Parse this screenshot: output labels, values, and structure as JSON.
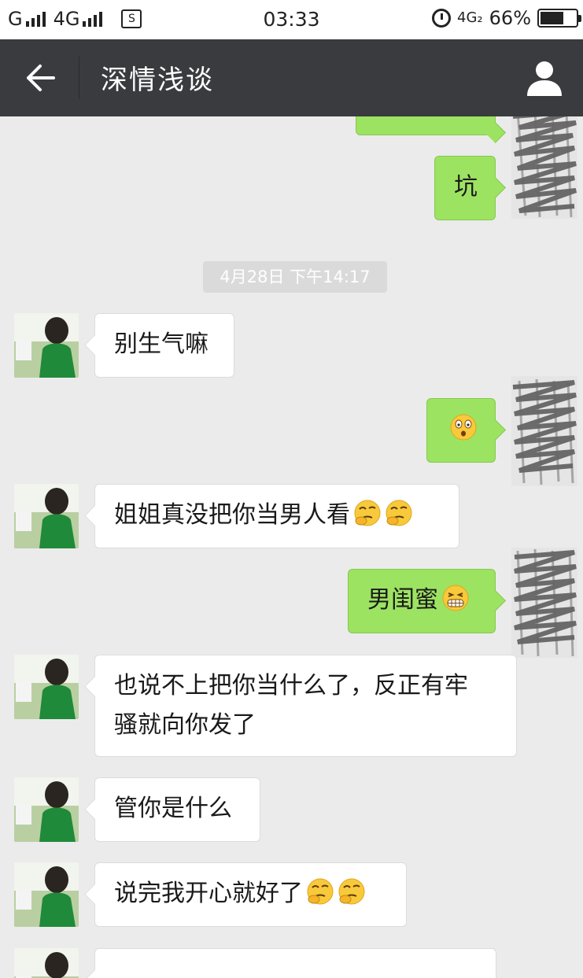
{
  "status_bar": {
    "carrier1": "G",
    "carrier2": "4G",
    "sim_label": "S",
    "time": "03:33",
    "network": "4G₂",
    "battery_text": "66%",
    "battery_level": 0.66
  },
  "header": {
    "title": "深情浅谈"
  },
  "chat": {
    "timestamp": "4月28日 下午14:17",
    "messages": [
      {
        "side": "right",
        "text": ""
      },
      {
        "side": "right",
        "text": "坑"
      },
      {
        "side": "left",
        "text": "别生气嘛"
      },
      {
        "side": "right",
        "text": "",
        "emojis": [
          "surprised-face-emoji"
        ]
      },
      {
        "side": "left",
        "text": "姐姐真没把你当男人看",
        "emojis": [
          "thinking-face-emoji",
          "thinking-face-emoji"
        ]
      },
      {
        "side": "right",
        "text": "男闺蜜",
        "emojis": [
          "grinning-face-emoji"
        ]
      },
      {
        "side": "left",
        "line1": "也说不上把你当什么了，反正有牢",
        "line2": "骚就向你发了"
      },
      {
        "side": "left",
        "text": "管你是什么"
      },
      {
        "side": "left",
        "text": "说完我开心就好了",
        "emojis": [
          "thinking-face-emoji",
          "thinking-face-emoji"
        ]
      },
      {
        "side": "left",
        "text": ""
      }
    ]
  },
  "colors": {
    "header_bg": "#3a3b3f",
    "chat_bg": "#ebebeb",
    "bubble_self": "#9de362",
    "bubble_other": "#ffffff"
  }
}
